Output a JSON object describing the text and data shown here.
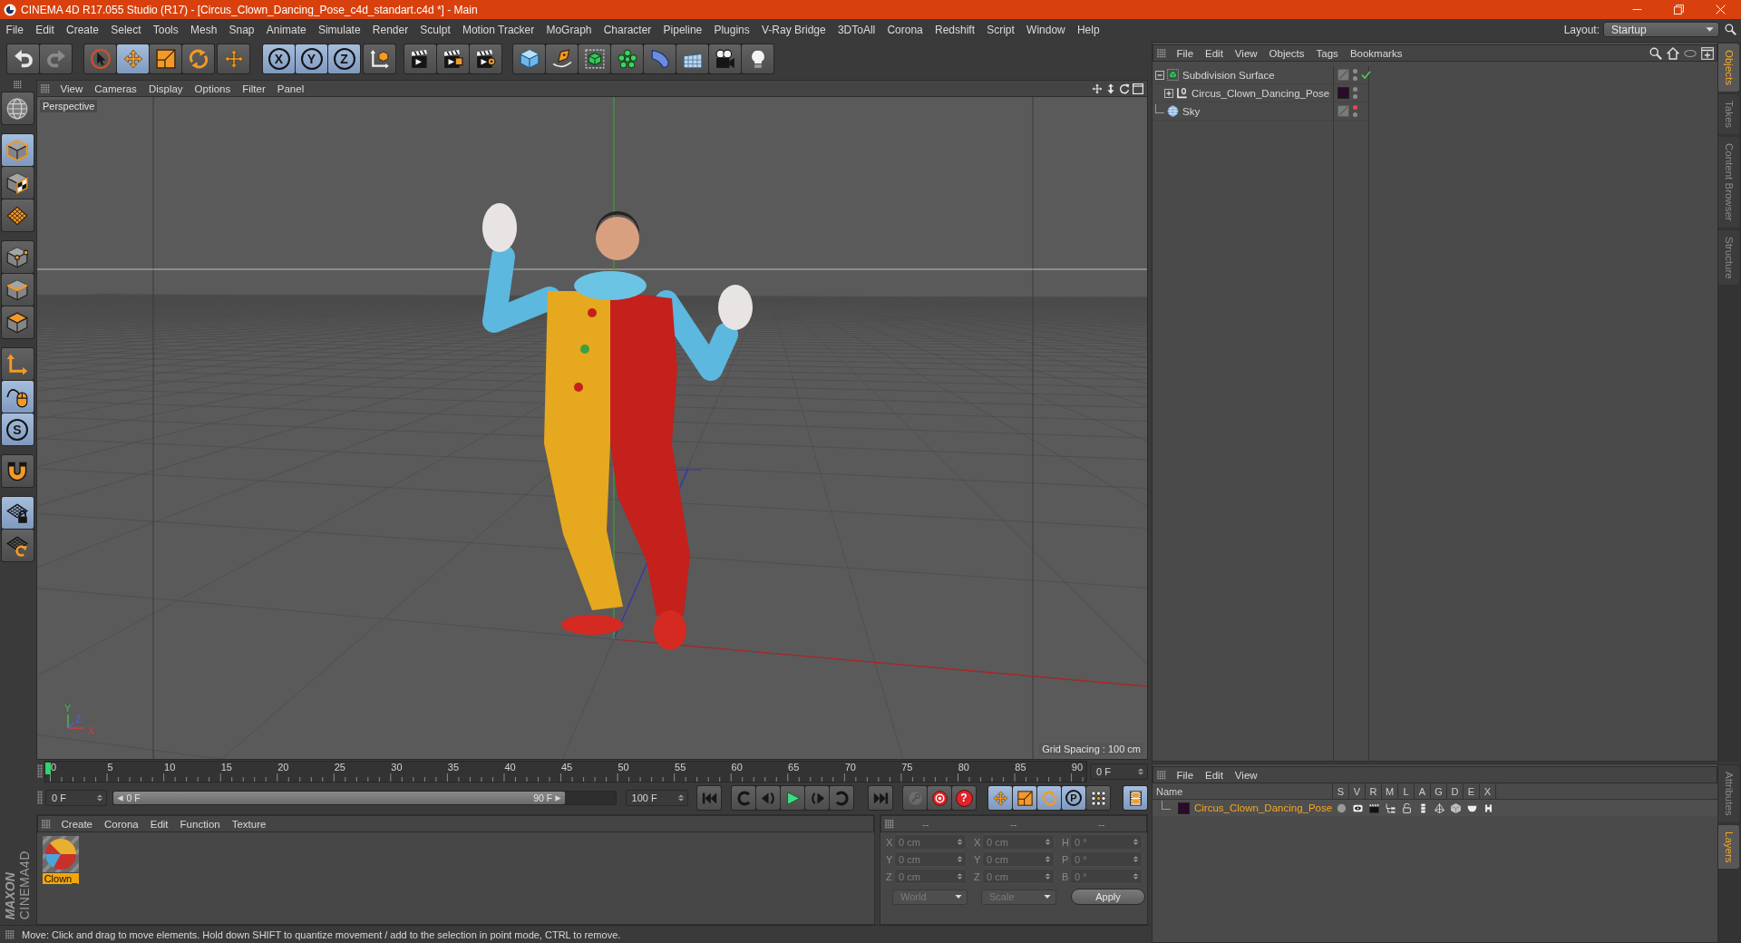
{
  "window": {
    "title": "CINEMA 4D R17.055 Studio (R17) - [Circus_Clown_Dancing_Pose_c4d_standart.c4d *] - Main"
  },
  "menu_bar": {
    "items": [
      "File",
      "Edit",
      "Create",
      "Select",
      "Tools",
      "Mesh",
      "Snap",
      "Animate",
      "Simulate",
      "Render",
      "Sculpt",
      "Motion Tracker",
      "MoGraph",
      "Character",
      "Pipeline",
      "Plugins",
      "V-Ray Bridge",
      "3DToAll",
      "Corona",
      "Redshift",
      "Script",
      "Window",
      "Help"
    ],
    "layout_label": "Layout:",
    "layout_value": "Startup"
  },
  "toolbar": [
    [
      {
        "active": false,
        "disabled": false
      },
      {
        "active": false,
        "disabled": true
      }
    ],
    [
      {
        "active": false,
        "disabled": false
      },
      {
        "active": true,
        "disabled": false
      },
      {
        "active": false,
        "disabled": false
      },
      {
        "active": false,
        "disabled": false
      }
    ],
    [
      {
        "active": false,
        "disabled": false
      }
    ],
    [
      {
        "label": "X",
        "active": true,
        "disabled": false
      },
      {
        "label": "Y",
        "active": true,
        "disabled": false
      },
      {
        "label": "Z",
        "active": true,
        "disabled": false
      }
    ],
    [
      {
        "active": false,
        "disabled": false
      }
    ],
    [
      {
        "active": false,
        "disabled": false
      },
      {
        "active": false,
        "disabled": false
      },
      {
        "active": false,
        "disabled": false
      }
    ],
    [
      {
        "active": false,
        "disabled": false
      },
      {
        "active": false,
        "disabled": false
      },
      {
        "active": false,
        "disabled": false
      },
      {
        "active": false,
        "disabled": false
      },
      {
        "active": false,
        "disabled": false
      },
      {
        "active": false,
        "disabled": false
      },
      {
        "active": false,
        "disabled": false
      },
      {
        "active": false,
        "disabled": false
      }
    ]
  ],
  "left_toolbar": [
    [
      {
        "active": false
      }
    ],
    [
      {
        "active": true
      },
      {
        "active": false
      },
      {
        "active": false
      }
    ],
    [
      {
        "active": false
      },
      {
        "active": false
      },
      {
        "active": false
      }
    ],
    [
      {
        "active": false
      },
      {
        "active": true
      },
      {
        "label": "S",
        "active": true
      }
    ],
    [
      {
        "active": false
      }
    ],
    [
      {
        "active": true
      },
      {
        "active": false
      }
    ]
  ],
  "logo": {
    "brand": "MAXON",
    "product": "CINEMA4D"
  },
  "viewport": {
    "menu": [
      "View",
      "Cameras",
      "Display",
      "Options",
      "Filter",
      "Panel"
    ],
    "camera": "Perspective",
    "axis_gizmo": [
      "Y",
      "Z",
      "X"
    ],
    "grid_spacing": "Grid Spacing : 100 cm"
  },
  "timeline": {
    "ticks": [
      "0",
      "5",
      "10",
      "15",
      "20",
      "25",
      "30",
      "35",
      "40",
      "45",
      "50",
      "55",
      "60",
      "65",
      "70",
      "75",
      "80",
      "85",
      "90"
    ],
    "level": 0,
    "current_frame": "0 F"
  },
  "transport": {
    "start_frame": "0 F",
    "range": {
      "start": "0 F",
      "end": "90 F",
      "level": 0.9
    },
    "end_frame": "100 F",
    "buttons": [
      [
        {
          "active": false
        }
      ],
      [
        {
          "active": false
        },
        {
          "active": false
        },
        {
          "active": false
        },
        {
          "active": false
        },
        {
          "active": false
        }
      ],
      [
        {
          "active": false
        }
      ],
      [
        {
          "active": false,
          "disabled": true
        },
        {
          "active": false,
          "disabled": false
        },
        {
          "label": "?",
          "active": false,
          "disabled": false
        }
      ],
      [
        {
          "active": true
        },
        {
          "active": true
        },
        {
          "active": true
        },
        {
          "label": "P",
          "active": true
        },
        {
          "active": false
        }
      ],
      [
        {
          "active": true
        }
      ]
    ]
  },
  "materials": {
    "menu": [
      "Create",
      "Corona",
      "Edit",
      "Function",
      "Texture"
    ],
    "items": [
      {
        "name": "Clown_",
        "selected": true
      }
    ]
  },
  "coordinates": {
    "disabled": true,
    "headers": [
      "--",
      "--",
      "--"
    ],
    "rows": [
      [
        {
          "label": "X",
          "value": "0 cm"
        },
        {
          "label": "X",
          "value": "0 cm"
        },
        {
          "label": "H",
          "value": "0 °"
        }
      ],
      [
        {
          "label": "Y",
          "value": "0 cm"
        },
        {
          "label": "Y",
          "value": "0 cm"
        },
        {
          "label": "P",
          "value": "0 °"
        }
      ],
      [
        {
          "label": "Z",
          "value": "0 cm"
        },
        {
          "label": "Z",
          "value": "0 cm"
        },
        {
          "label": "B",
          "value": "0 °"
        }
      ]
    ],
    "dropdowns": [
      "World",
      "Scale"
    ],
    "apply": "Apply"
  },
  "status_bar": {
    "text": "Move: Click and drag to move elements. Hold down SHIFT to quantize movement / add to the selection in point mode, CTRL to remove."
  },
  "objects_panel": {
    "menu": [
      "File",
      "Edit",
      "View",
      "Objects",
      "Tags",
      "Bookmarks"
    ],
    "tree": [
      {
        "name": "Subdivision Surface",
        "kind": "generator",
        "expanded": true,
        "enabled": true,
        "editor_visible": true,
        "children": [
          {
            "name": "Circus_Clown_Dancing_Pose",
            "kind": "null",
            "expanded": false,
            "color": "#2b0a2b",
            "editor_visible": true
          }
        ]
      },
      {
        "name": "Sky",
        "kind": "sky",
        "editor_visible": false
      }
    ]
  },
  "layers_panel": {
    "menu": [
      "File",
      "Edit",
      "View"
    ],
    "columns": [
      "Name",
      "S",
      "V",
      "R",
      "M",
      "L",
      "A",
      "G",
      "D",
      "E",
      "X"
    ],
    "rows": [
      {
        "name": "Circus_Clown_Dancing_Pose",
        "color": "#2b0a2b",
        "selected": true
      }
    ]
  },
  "side_tabs": {
    "top": [
      {
        "label": "Objects",
        "selected": true
      },
      {
        "label": "Takes",
        "selected": false
      },
      {
        "label": "Content Browser",
        "selected": false
      },
      {
        "label": "Structure",
        "selected": false
      }
    ],
    "bottom": [
      {
        "label": "Attributes",
        "selected": false
      },
      {
        "label": "Layers",
        "selected": true
      }
    ]
  }
}
